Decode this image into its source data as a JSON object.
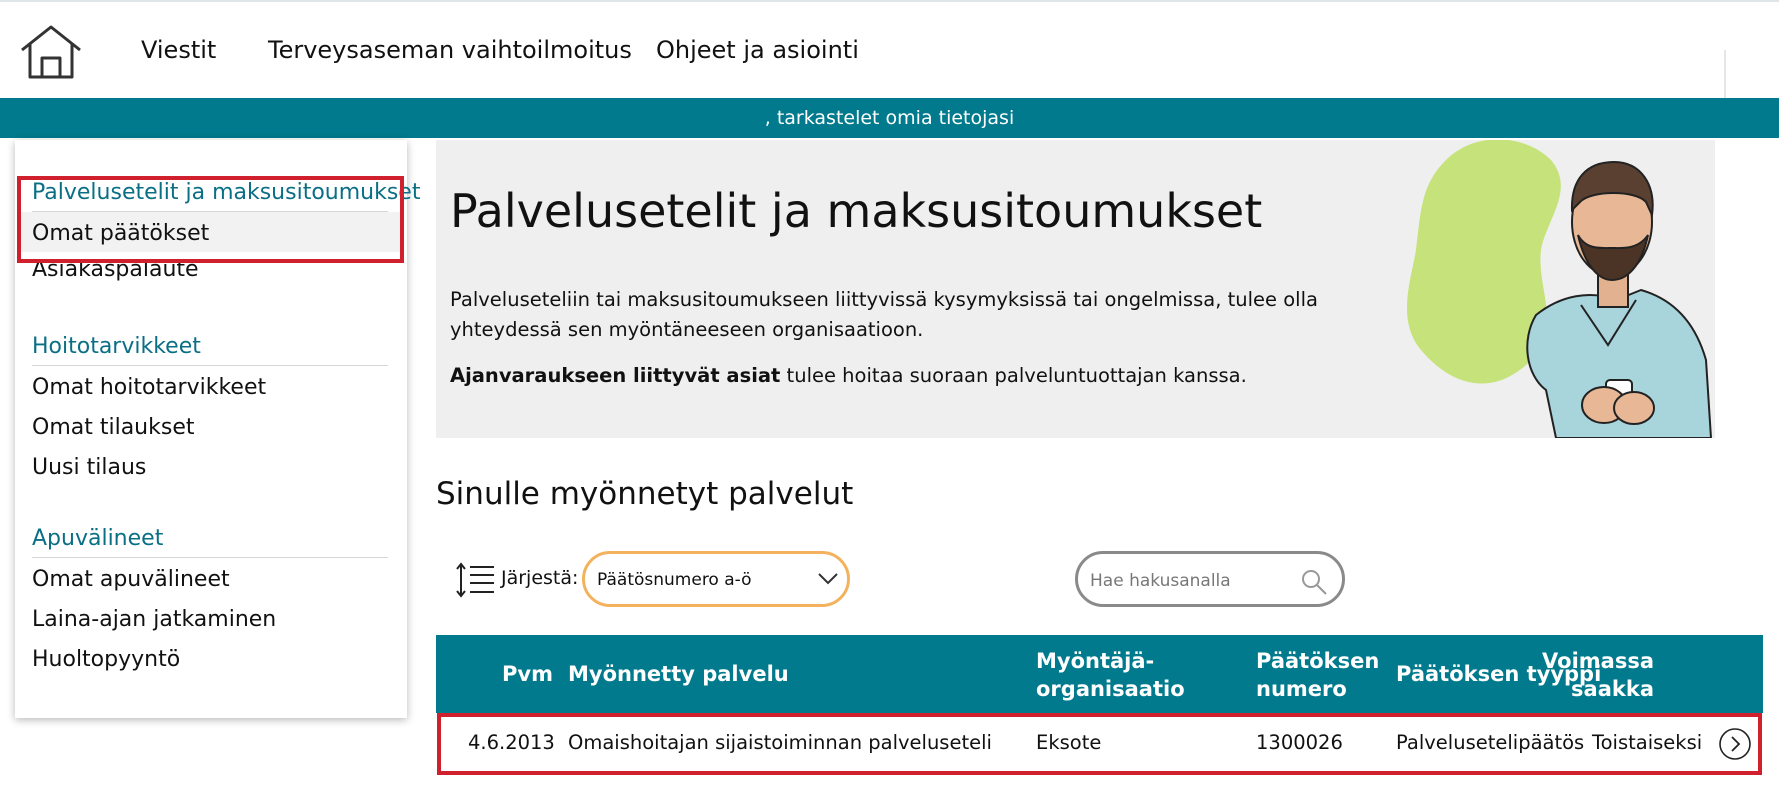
{
  "nav": {
    "items": [
      "Viestit",
      "Terveysaseman vaihtoilmoitus",
      "Ohjeet ja asiointi"
    ]
  },
  "userbar": {
    "text": ", tarkastelet omia tietojasi"
  },
  "sidebar": {
    "groups": [
      {
        "heading": "Palvelusetelit ja maksusitoumukset",
        "links": [
          "Omat päätökset",
          "Asiakaspalaute"
        ]
      },
      {
        "heading": "Hoitotarvikkeet",
        "links": [
          "Omat hoitotarvikkeet",
          "Omat tilaukset",
          "Uusi tilaus"
        ]
      },
      {
        "heading": "Apuvälineet",
        "links": [
          "Omat apuvälineet",
          "Laina-ajan jatkaminen",
          "Huoltopyyntö"
        ]
      }
    ]
  },
  "hero": {
    "title": "Palvelusetelit ja maksusitoumukset",
    "text": "Palveluseteliin tai maksusitoumukseen liittyvissä kysymyksissä tai ongelmissa, tulee olla yhteydessä sen myöntäneeseen organisaatioon.",
    "text2_bold": "Ajanvaraukseen liittyvät asiat",
    "text2_rest": " tulee hoitaa suoraan palveluntuottajan kanssa."
  },
  "services": {
    "title": "Sinulle myönnetyt palvelut",
    "sort_label": "Järjestä:",
    "sort_value": "Päätösnumero a-ö",
    "search_placeholder": "Hae hakusanalla"
  },
  "table": {
    "headers": {
      "pvm": "Pvm",
      "palvelu": "Myönnetty palvelu",
      "org_1": "Myöntäjä-",
      "org_2": "organisaatio",
      "num_1": "Päätöksen",
      "num_2": "numero",
      "tyyppi": "Päätöksen tyyppi",
      "voim_1": "Voimassa",
      "voim_2": "saakka"
    },
    "rows": [
      {
        "pvm": "4.6.2013",
        "palvelu": "Omaishoitajan sijaistoiminnan palveluseteli",
        "org": "Eksote",
        "num": "1300026",
        "tyyppi": "Palvelusetelipäätös",
        "voim": "Toistaiseksi"
      }
    ]
  },
  "colors": {
    "accent": "#007a8c",
    "heading": "#0a6f85",
    "highlight": "#d0202e",
    "select_border": "#f4b25e"
  }
}
